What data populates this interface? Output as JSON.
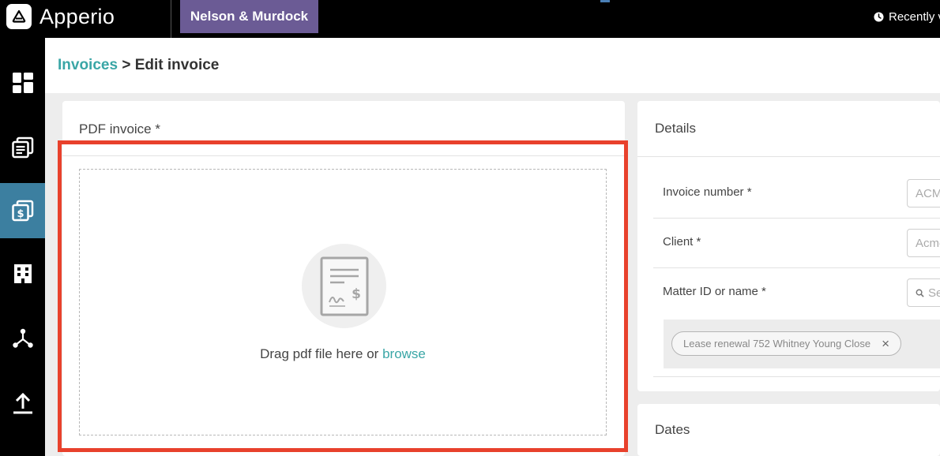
{
  "app": {
    "name": "Apperio"
  },
  "topbar": {
    "firm": "Nelson & Murdock",
    "recent": "Recently viewed"
  },
  "sidebar": {
    "items": [
      {
        "icon": "dashboard-icon"
      },
      {
        "icon": "documents-icon"
      },
      {
        "icon": "invoice-icon",
        "active": true
      },
      {
        "icon": "building-icon"
      },
      {
        "icon": "network-icon"
      },
      {
        "icon": "upload-icon"
      }
    ]
  },
  "breadcrumb": {
    "parent": "Invoices",
    "separator": ">",
    "current": "Edit invoice"
  },
  "pdf": {
    "title": "PDF invoice *",
    "drop_text": "Drag pdf file here or",
    "browse": "browse",
    "icon": "invoice-document-icon"
  },
  "details": {
    "title": "Details",
    "invoice_number": {
      "label": "Invoice number *",
      "value": "ACME"
    },
    "client": {
      "label": "Client *",
      "value": "Acme"
    },
    "matter": {
      "label": "Matter ID or name *",
      "placeholder": "Search"
    },
    "tag": "Lease renewal 752 Whitney Young Close"
  },
  "dates": {
    "title": "Dates"
  },
  "colors": {
    "accent": "#3aa6a6",
    "firm_tab": "#6b5b95",
    "active_nav": "#3c7fa0",
    "highlight": "#e8412c"
  }
}
